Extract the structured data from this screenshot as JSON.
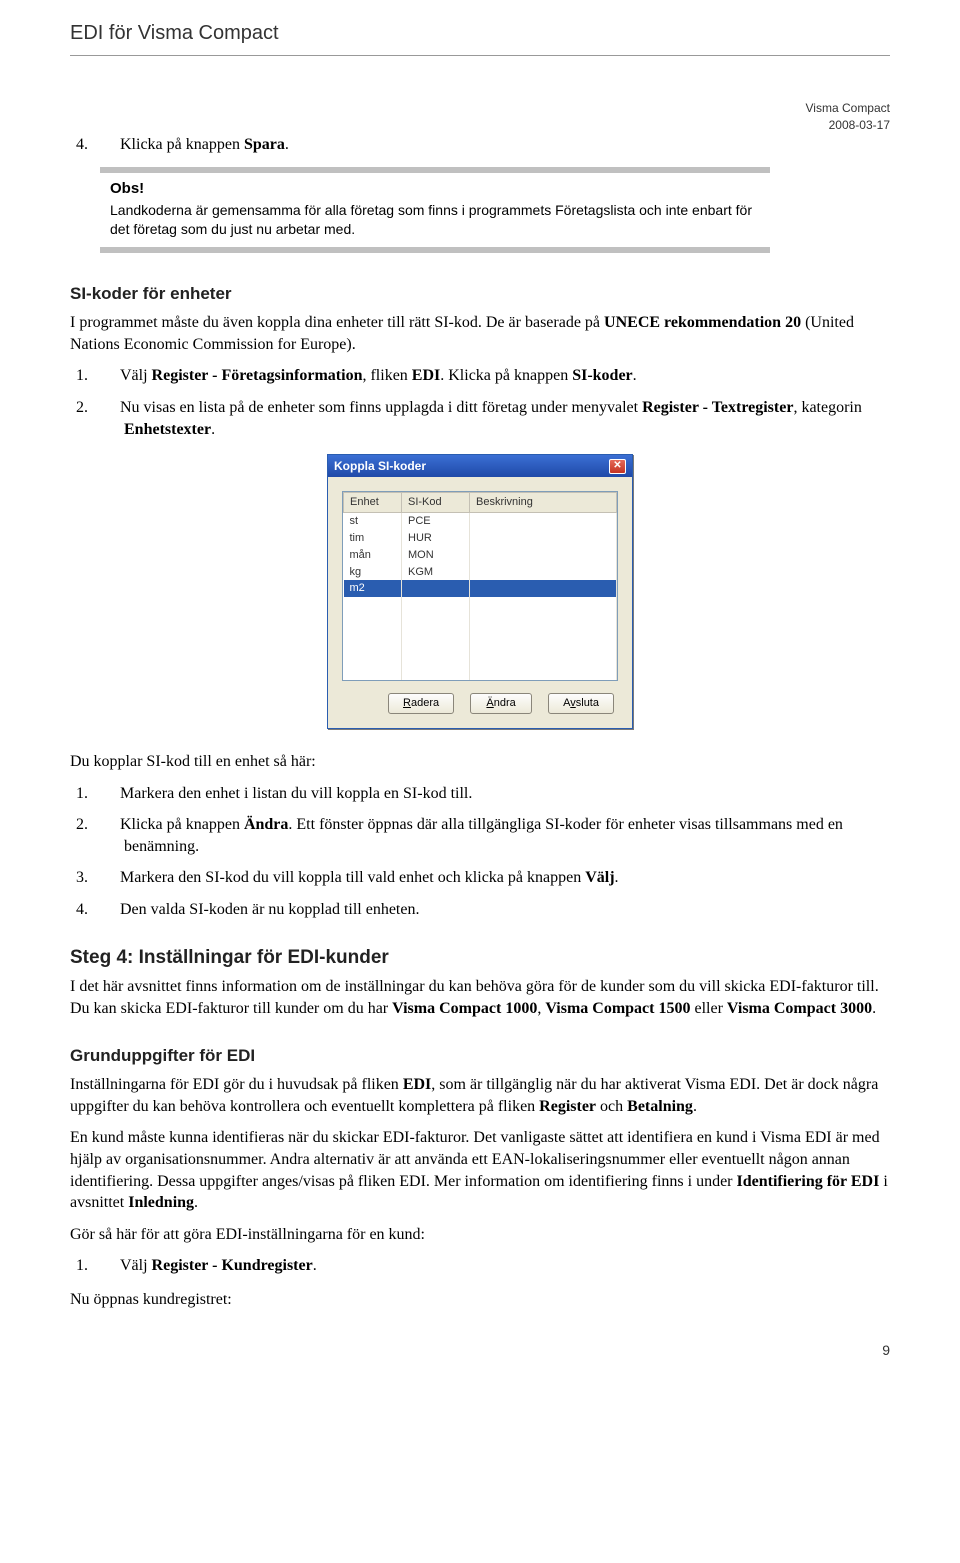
{
  "header": {
    "title_prefix": "EDI",
    "title_rest": " för Visma Compact",
    "meta_line1": "Visma Compact",
    "meta_line2": "2008-03-17"
  },
  "list1": {
    "item4_num": "4.",
    "item4_a": "Klicka på knappen ",
    "item4_b": "Spara",
    "item4_c": "."
  },
  "obs": {
    "title": "Obs!",
    "text": "Landkoderna är gemensamma för alla företag som finns i programmets Företagslista och inte enbart för det företag som du just nu arbetar med."
  },
  "si": {
    "heading": "SI-koder för enheter",
    "p1_a": "I programmet måste du även koppla dina enheter till rätt SI-kod. De är baserade på ",
    "p1_b": "UNECE rekommendation 20",
    "p1_c": " (United Nations Economic Commission for Europe).",
    "item1_num": "1.",
    "item1_a": "Välj ",
    "item1_b": "Register - Företagsinformation",
    "item1_c": ", fliken ",
    "item1_d": "EDI",
    "item1_e": ". Klicka på knappen ",
    "item1_f": "SI-koder",
    "item1_g": ".",
    "item2_num": "2.",
    "item2_a": "Nu visas en lista på de enheter som finns upplagda i ditt företag under menyvalet ",
    "item2_b": "Register - Textregister",
    "item2_c": ", kategorin ",
    "item2_d": "Enhetstexter",
    "item2_e": "."
  },
  "dialog": {
    "title": "Koppla SI-koder",
    "col1": "Enhet",
    "col2": "SI-Kod",
    "col3": "Beskrivning",
    "rows": [
      {
        "c1": "st",
        "c2": "PCE",
        "c3": ""
      },
      {
        "c1": "tim",
        "c2": "HUR",
        "c3": ""
      },
      {
        "c1": "mån",
        "c2": "MON",
        "c3": ""
      },
      {
        "c1": "kg",
        "c2": "KGM",
        "c3": ""
      }
    ],
    "selrow": {
      "c1": "m2",
      "c2": "",
      "c3": ""
    },
    "btn_radera": "Radera",
    "btn_andra": "Ändra",
    "btn_avsluta": "Avsluta"
  },
  "post": {
    "lead": "Du kopplar SI-kod till en enhet så här:",
    "i1_num": "1.",
    "i1": "Markera den enhet i listan du vill koppla en SI-kod till.",
    "i2_num": "2.",
    "i2_a": "Klicka på knappen ",
    "i2_b": "Ändra",
    "i2_c": ". Ett fönster öppnas där alla tillgängliga SI-koder för enheter visas tillsammans med en benämning.",
    "i3_num": "3.",
    "i3_a": "Markera den SI-kod du vill koppla till vald enhet och klicka på knappen ",
    "i3_b": "Välj",
    "i3_c": ".",
    "i4_num": "4.",
    "i4": "Den valda SI-koden är nu kopplad till enheten."
  },
  "step4": {
    "heading": "Steg 4: Inställningar för EDI-kunder",
    "p1_a": "I det här avsnittet finns information om de inställningar du kan behöva göra för de kunder som du vill skicka EDI-fakturor till. Du kan skicka EDI-fakturor till kunder om du har ",
    "p1_b": "Visma Compact 1000",
    "p1_c": ", ",
    "p1_d": "Visma Compact 1500",
    "p1_e": " eller ",
    "p1_f": "Visma Compact 3000",
    "p1_g": "."
  },
  "grund": {
    "heading": "Grunduppgifter för EDI",
    "p1_a": "Inställningarna för EDI gör du i huvudsak på fliken ",
    "p1_b": "EDI",
    "p1_c": ", som är tillgänglig när du har aktiverat Visma EDI. Det är dock några uppgifter du kan behöva kontrollera och eventuellt komplettera på fliken ",
    "p1_d": "Register",
    "p1_e": " och ",
    "p1_f": "Betalning",
    "p1_g": ".",
    "p2_a": "En kund måste kunna identifieras när du skickar EDI-fakturor. Det vanligaste sättet att identifiera en kund i Visma EDI är med hjälp av organisationsnummer. Andra alternativ är att använda ett EAN-lokaliseringsnummer eller eventuellt någon annan identifiering. Dessa uppgifter anges/visas på fliken EDI. Mer information om identifiering finns i under ",
    "p2_b": "Identifiering för EDI",
    "p2_c": " i avsnittet ",
    "p2_d": "Inledning",
    "p2_e": ".",
    "p3": "Gör så här för att göra EDI-inställningarna för en kund:",
    "i1_num": "1.",
    "i1_a": "Välj ",
    "i1_b": "Register - Kundregister",
    "i1_c": ".",
    "tail": "Nu öppnas kundregistret:"
  },
  "page_number": "9"
}
